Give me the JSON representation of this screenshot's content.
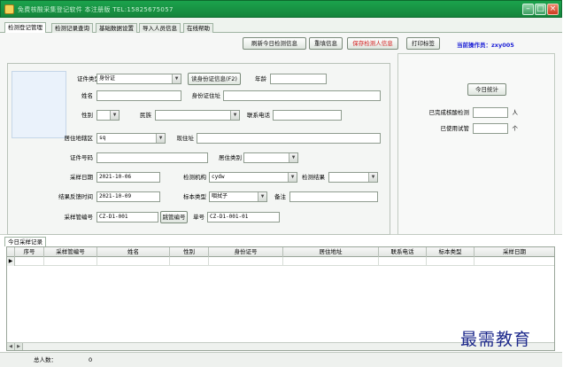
{
  "window": {
    "title": "免费核酸采集登记软件 本注册版 TEL:15825675057"
  },
  "tabs": [
    {
      "label": "检测登记管理",
      "active": true
    },
    {
      "label": "检测记录查询",
      "active": false
    },
    {
      "label": "基础数据设置",
      "active": false
    },
    {
      "label": "导入人员信息",
      "active": false
    },
    {
      "label": "在线帮助",
      "active": false
    }
  ],
  "toolbar": {
    "refresh_label": "刷新今日检测信息",
    "reset_label": "重填信息",
    "save_label": "保存检测人信息",
    "print_label": "打印标签",
    "operator_label": "当前操作员：zxy005"
  },
  "form": {
    "id_type_label": "证件类型",
    "id_type_value": "身份证",
    "read_id_button": "读身份证信息(F2)",
    "age_label": "年龄",
    "age_value": "",
    "name_label": "姓名",
    "name_value": "",
    "id_address_label": "身份证住址",
    "id_address_value": "",
    "gender_label": "性别",
    "gender_value": "",
    "ethnicity_label": "民族",
    "ethnicity_value": "",
    "phone_label": "联系电话",
    "phone_value": "",
    "district_label": "居住地辖区",
    "district_value": "sq",
    "current_address_label": "现住址",
    "current_address_value": "",
    "id_number_label": "证件号码",
    "id_number_value": "",
    "resident_type_label": "居住类别",
    "resident_type_value": "",
    "sample_date_label": "采样日期",
    "sample_date_value": "2021-10-06",
    "institution_label": "检测机构",
    "institution_value": "cydw",
    "result_label": "检测结果",
    "result_value": "",
    "feedback_time_label": "结果反馈时间",
    "feedback_time_value": "2021-10-09",
    "sample_type_label": "标本类型",
    "sample_type_value": "咽拭子",
    "remark_label": "备注",
    "remark_value": "",
    "tube_no_label": "采样管编号",
    "tube_no_value": "CZ-D1-001",
    "skip_tube_button": "跳管编号",
    "serial_label": "单号",
    "serial_value": "CZ-D1-001-01"
  },
  "stats": {
    "today_button": "今日统计",
    "completed_label": "已完成核酸检测",
    "completed_value": "",
    "completed_unit": "人",
    "tubes_used_label": "已使用试管",
    "tubes_used_value": "",
    "tubes_used_unit": "个"
  },
  "records": {
    "tab_label": "今日采样记录",
    "columns": [
      "序号",
      "采样管编号",
      "姓名",
      "性别",
      "身份证号",
      "居住地址",
      "联系电话",
      "标本类型",
      "采样日期"
    ]
  },
  "status": {
    "total_label": "总人数：",
    "total_value": "0"
  },
  "watermark": {
    "text": "最需教育"
  }
}
